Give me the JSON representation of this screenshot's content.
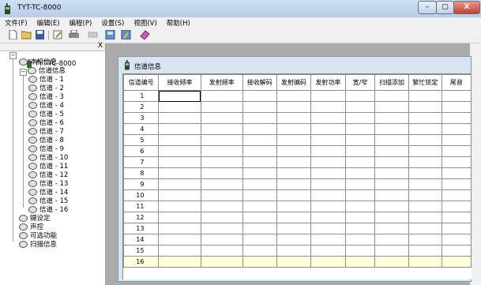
{
  "window": {
    "title": "TYT-TC-8000",
    "minimize": "–",
    "maximize": "▢",
    "close": "X"
  },
  "menu": [
    "文件(F)",
    "编辑(E)",
    "编程(P)",
    "设置(S)",
    "视图(V)",
    "帮助(H)"
  ],
  "panel": {
    "close": "X"
  },
  "tree": {
    "root": "TYT-TC-8000",
    "local_info": "本机信息",
    "channel_info": "信道信息",
    "channels": [
      "信道 - 1",
      "信道 - 2",
      "信道 - 3",
      "信道 - 4",
      "信道 - 5",
      "信道 - 6",
      "信道 - 7",
      "信道 - 8",
      "信道 - 9",
      "信道 - 10",
      "信道 - 11",
      "信道 - 12",
      "信道 - 13",
      "信道 - 14",
      "信道 - 15",
      "信道 - 16"
    ],
    "others": [
      "键设定",
      "声控",
      "可选功能",
      "扫描信息"
    ]
  },
  "child_window": {
    "title": "信道信息",
    "columns": [
      "信道编号",
      "接收频率",
      "发射频率",
      "接收解码",
      "发射编码",
      "发射功率",
      "宽/窄",
      "扫描添加",
      "繁忙锁定",
      "尾音"
    ],
    "rows": [
      "1",
      "2",
      "3",
      "4",
      "5",
      "6",
      "7",
      "8",
      "9",
      "10",
      "11",
      "12",
      "13",
      "14",
      "15",
      "16"
    ]
  }
}
